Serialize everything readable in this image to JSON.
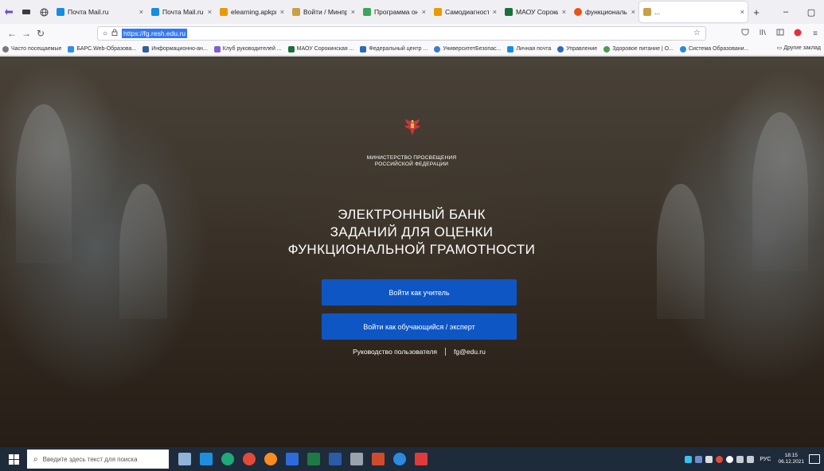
{
  "browser": {
    "tabs": [
      {
        "title": "Почта Mail.ru",
        "icon_color": "#168de2",
        "close": "×",
        "active": false
      },
      {
        "title": "Почта Mail.ru",
        "icon_color": "#168de2",
        "close": "×",
        "active": false
      },
      {
        "title": "elearning.apkpro.ru | ",
        "icon_color": "#e89b00",
        "close": "×",
        "active": false
      },
      {
        "title": "Войти / Минпросвещ",
        "icon_color": "#c8a046",
        "close": "×",
        "active": false
      },
      {
        "title": "Программа онлайн-",
        "icon_color": "#3aa757",
        "close": "×",
        "active": false
      },
      {
        "title": "Самодиагностика ул",
        "icon_color": "#e89b00",
        "close": "×",
        "active": false
      },
      {
        "title": "МАОУ Сорокинская",
        "icon_color": "#1b6f3a",
        "close": "×",
        "active": false
      },
      {
        "title": "функциональная гр",
        "icon_color": "#e8541a",
        "close": "×",
        "active": false
      },
      {
        "title": "...",
        "icon_color": "#c8a046",
        "close": "×",
        "active": true
      }
    ],
    "new_tab": "+",
    "window_controls": {
      "minimize": "–",
      "restore": "▢"
    },
    "url": "https://fg.resh.edu.ru",
    "bookmarks": [
      {
        "label": "Часто посещаемые",
        "icon_color": "#7a7a7a"
      },
      {
        "label": "БАРС.Web-Образова...",
        "icon_color": "#2f8fe8"
      },
      {
        "label": "Информационно-ан...",
        "icon_color": "#355c9b"
      },
      {
        "label": "Клуб руководителей ...",
        "icon_color": "#7f5fd0"
      },
      {
        "label": "МАОУ Сорокинская ...",
        "icon_color": "#1b6f3a"
      },
      {
        "label": "Федеральный центр ...",
        "icon_color": "#2f6ab8"
      },
      {
        "label": "УниверситетБезопас...",
        "icon_color": "#3a7bd5"
      },
      {
        "label": "Личная почта",
        "icon_color": "#168de2"
      },
      {
        "label": "Управление",
        "icon_color": "#2d68c4"
      },
      {
        "label": "Здоровое питание | О...",
        "icon_color": "#48a04a"
      },
      {
        "label": "Система Образовани...",
        "icon_color": "#2b8ad8"
      }
    ],
    "other_bookmarks": "Другие заклад"
  },
  "page": {
    "ministry_lines": [
      "МИНИСТЕРСТВО ПРОСВЕЩЕНИЯ",
      "РОССИЙСКОЙ ФЕДЕРАЦИИ"
    ],
    "headline_lines": [
      "ЭЛЕКТРОННЫЙ БАНК",
      "ЗАДАНИЙ ДЛЯ ОЦЕНКИ",
      "ФУНКЦИОНАЛЬНОЙ ГРАМОТНОСТИ"
    ],
    "login_teacher": "Войти как учитель",
    "login_student": "Войти как обучающийся / эксперт",
    "user_guide": "Руководство пользователя",
    "email": "fg@edu.ru",
    "accent_color": "#0e56c4"
  },
  "taskbar": {
    "search_placeholder": "Введите здесь текст для поиска",
    "language": "РУС",
    "time": "18:15",
    "date": "06.12.2021"
  }
}
